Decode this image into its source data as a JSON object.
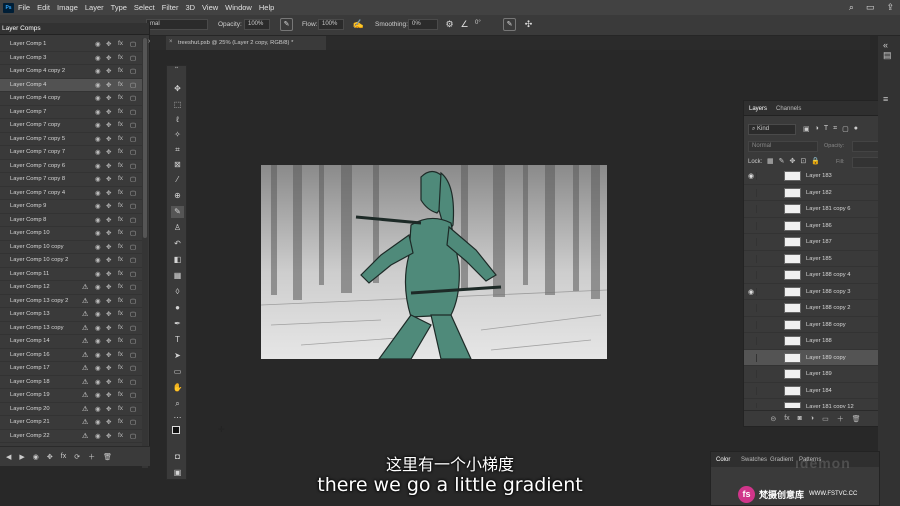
{
  "menu": [
    "File",
    "Edit",
    "Image",
    "Layer",
    "Type",
    "Select",
    "Filter",
    "3D",
    "View",
    "Window",
    "Help"
  ],
  "app_logo": "Ps",
  "options": {
    "mode_value": "mal",
    "opacity_label": "Opacity:",
    "opacity_value": "100%",
    "flow_label": "Flow:",
    "flow_value": "100%",
    "smoothing_label": "Smoothing:",
    "smoothing_value": "0%",
    "angle_value": "0°"
  },
  "layer_comps": {
    "panel_title": "Layer Comps",
    "items": [
      {
        "name": "Layer Comp 1",
        "warn": false,
        "selected": false
      },
      {
        "name": "Layer Comp 3",
        "warn": false,
        "selected": false
      },
      {
        "name": "Layer Comp 4 copy 2",
        "warn": false,
        "selected": false
      },
      {
        "name": "Layer Comp 4",
        "warn": false,
        "selected": true
      },
      {
        "name": "Layer Comp 4 copy",
        "warn": false,
        "selected": false
      },
      {
        "name": "Layer Comp 7",
        "warn": false,
        "selected": false
      },
      {
        "name": "Layer Comp 7 copy",
        "warn": false,
        "selected": false
      },
      {
        "name": "Layer Comp 7 copy 5",
        "warn": false,
        "selected": false
      },
      {
        "name": "Layer Comp 7 copy 7",
        "warn": false,
        "selected": false
      },
      {
        "name": "Layer Comp 7 copy 6",
        "warn": false,
        "selected": false
      },
      {
        "name": "Layer Comp 7 copy 8",
        "warn": false,
        "selected": false
      },
      {
        "name": "Layer Comp 7 copy 4",
        "warn": false,
        "selected": false
      },
      {
        "name": "Layer Comp 9",
        "warn": false,
        "selected": false
      },
      {
        "name": "Layer Comp 8",
        "warn": false,
        "selected": false
      },
      {
        "name": "Layer Comp 10",
        "warn": false,
        "selected": false
      },
      {
        "name": "Layer Comp 10 copy",
        "warn": false,
        "selected": false
      },
      {
        "name": "Layer Comp 10 copy 2",
        "warn": false,
        "selected": false
      },
      {
        "name": "Layer Comp 11",
        "warn": false,
        "selected": false
      },
      {
        "name": "Layer Comp 12",
        "warn": true,
        "selected": false
      },
      {
        "name": "Layer Comp 13 copy 2",
        "warn": true,
        "selected": false
      },
      {
        "name": "Layer Comp 13",
        "warn": true,
        "selected": false
      },
      {
        "name": "Layer Comp 13 copy",
        "warn": true,
        "selected": false
      },
      {
        "name": "Layer Comp 14",
        "warn": true,
        "selected": false
      },
      {
        "name": "Layer Comp 16",
        "warn": true,
        "selected": false
      },
      {
        "name": "Layer Comp 17",
        "warn": true,
        "selected": false
      },
      {
        "name": "Layer Comp 18",
        "warn": true,
        "selected": false
      },
      {
        "name": "Layer Comp 19",
        "warn": true,
        "selected": false
      },
      {
        "name": "Layer Comp 20",
        "warn": true,
        "selected": false
      },
      {
        "name": "Layer Comp 21",
        "warn": true,
        "selected": false
      },
      {
        "name": "Layer Comp 22",
        "warn": true,
        "selected": false
      }
    ]
  },
  "document": {
    "tab_title": "treeshut.psb @ 25% (Layer 2 copy, RGB/8) *"
  },
  "layers_panel": {
    "tab_layers": "Layers",
    "tab_channels": "Channels",
    "filter_kind": "Kind",
    "blend_mode": "Normal",
    "opacity_label": "Opacity:",
    "lock_label": "Lock:",
    "fill_label": "Fill:",
    "layers": [
      {
        "name": "Layer 183",
        "visible": true,
        "selected": false
      },
      {
        "name": "Layer 182",
        "visible": false,
        "selected": false
      },
      {
        "name": "Layer 181 copy 6",
        "visible": false,
        "selected": false
      },
      {
        "name": "Layer 186",
        "visible": false,
        "selected": false
      },
      {
        "name": "Layer 187",
        "visible": false,
        "selected": false
      },
      {
        "name": "Layer 185",
        "visible": false,
        "selected": false
      },
      {
        "name": "Layer 188 copy 4",
        "visible": false,
        "selected": false
      },
      {
        "name": "Layer 188 copy 3",
        "visible": true,
        "selected": false
      },
      {
        "name": "Layer 188 copy 2",
        "visible": false,
        "selected": false
      },
      {
        "name": "Layer 188 copy",
        "visible": false,
        "selected": false
      },
      {
        "name": "Layer 188",
        "visible": false,
        "selected": false
      },
      {
        "name": "Layer 189 copy",
        "visible": false,
        "selected": true
      },
      {
        "name": "Layer 189",
        "visible": false,
        "selected": false
      },
      {
        "name": "Layer 184",
        "visible": false,
        "selected": false
      },
      {
        "name": "Layer 181 copy 12",
        "visible": false,
        "selected": false
      }
    ]
  },
  "color_panel": {
    "tabs": [
      "Color",
      "Swatches",
      "Gradient",
      "Patterns"
    ]
  },
  "subtitles": {
    "chinese": "这里有一个小梯度",
    "english": "there we go a little gradient"
  },
  "watermark": {
    "logo": "fs",
    "brand": "梵摄创意库",
    "url": "WWW.FSTVC.CC"
  },
  "colors": {
    "figure_teal": "#4f8a7a",
    "panel_bg": "#3a3a3a",
    "workspace_bg": "#282828"
  }
}
